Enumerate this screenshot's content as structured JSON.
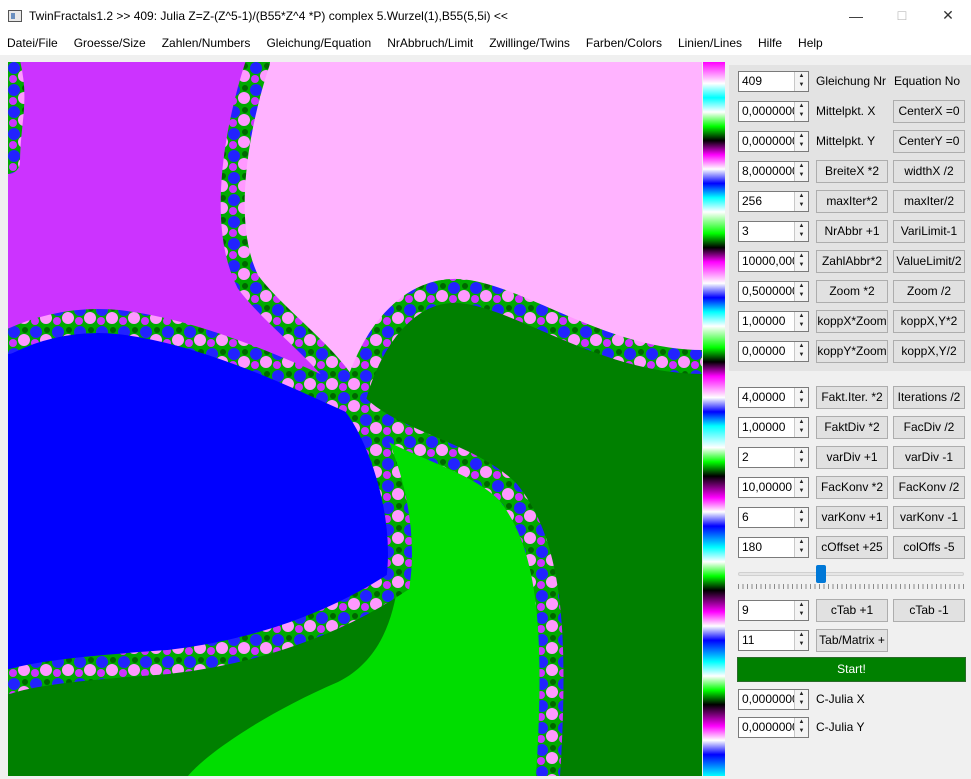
{
  "window": {
    "title": "TwinFractals1.2 >> 409: Julia Z=Z-(Z^5-1)/(B55*Z^4 *P) complex 5.Wurzel(1),B55(5,5i) <<",
    "minimize_glyph": "—",
    "maximize_glyph": "☐",
    "close_glyph": "✕"
  },
  "menu": [
    "Datei/File",
    "Groesse/Size",
    "Zahlen/Numbers",
    "Gleichung/Equation",
    "NrAbbruch/Limit",
    "Zwillinge/Twins",
    "Farben/Colors",
    "Linien/Lines",
    "Hilfe",
    "Help"
  ],
  "fractal_colors": {
    "top_left": "#cc33ff",
    "top_right": "#ffb3ff",
    "left_blue": "#0000ff",
    "bottom_light_green": "#00dd00",
    "bottom_dark_green": "#008000"
  },
  "params_top": [
    {
      "value": "409",
      "label": "Gleichung Nr",
      "right": "Equation No",
      "kind": "label-label"
    },
    {
      "value": "0,0000000",
      "label": "Mittelpkt. X",
      "right": "CenterX =0",
      "kind": "label-button"
    },
    {
      "value": "0,0000000",
      "label": "Mittelpkt. Y",
      "right": "CenterY =0",
      "kind": "label-button"
    },
    {
      "value": "8,0000000",
      "label": "BreiteX *2",
      "right": "widthX /2",
      "kind": "button-button"
    },
    {
      "value": "256",
      "label": "maxIter*2",
      "right": "maxIter/2",
      "kind": "button-button"
    },
    {
      "value": "3",
      "label": "NrAbbr +1",
      "right": "VariLimit-1",
      "kind": "button-button"
    },
    {
      "value": "10000,000",
      "label": "ZahlAbbr*2",
      "right": "ValueLimit/2",
      "kind": "button-button"
    },
    {
      "value": "0,5000000",
      "label": "Zoom *2",
      "right": "Zoom /2",
      "kind": "button-button"
    },
    {
      "value": "1,00000",
      "label": "koppX*Zoom",
      "right": "koppX,Y*2",
      "kind": "button-button"
    },
    {
      "value": "0,00000",
      "label": "koppY*Zoom",
      "right": "koppX,Y/2",
      "kind": "button-button"
    }
  ],
  "params_bottom": [
    {
      "value": "4,00000",
      "left": "Fakt.Iter. *2",
      "right": "Iterations /2"
    },
    {
      "value": "1,00000",
      "left": "FaktDiv *2",
      "right": "FacDiv /2"
    },
    {
      "value": "2",
      "left": "varDiv +1",
      "right": "varDiv -1"
    },
    {
      "value": "10,00000",
      "left": "FacKonv *2",
      "right": "FacKonv /2"
    },
    {
      "value": "6",
      "left": "varKonv +1",
      "right": "varKonv -1"
    },
    {
      "value": "180",
      "left": "cOffset +25",
      "right": "colOffs -5"
    }
  ],
  "slider": {
    "value": 0.36
  },
  "ctab": {
    "value": "9",
    "left": "cTab +1",
    "right": "cTab -1"
  },
  "matrix": {
    "value": "11",
    "left": "Tab/Matrix +"
  },
  "start_label": "Start!",
  "cjulia": [
    {
      "value": "0,0000000",
      "label": "C-Julia X"
    },
    {
      "value": "0,0000000",
      "label": "C-Julia Y"
    }
  ]
}
